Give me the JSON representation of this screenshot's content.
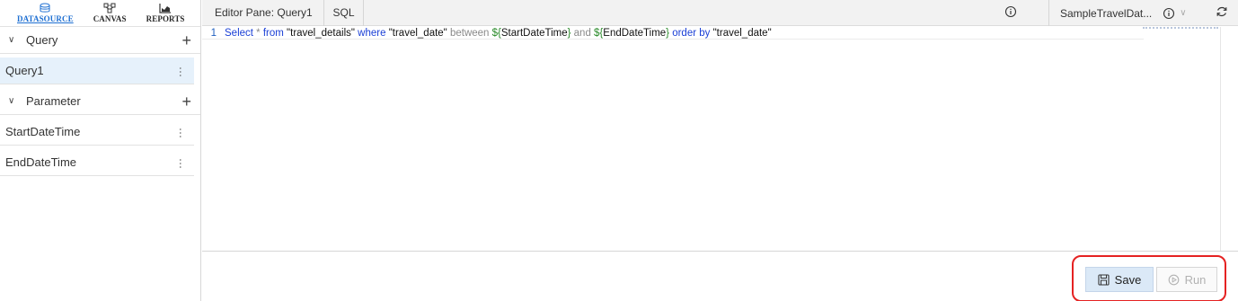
{
  "nav": {
    "datasource": "DATASOURCE",
    "canvas": "CANVAS",
    "reports": "REPORTS"
  },
  "sidebar": {
    "query_section": {
      "title": "Query",
      "items": [
        "Query1"
      ]
    },
    "parameter_section": {
      "title": "Parameter",
      "items": [
        "StartDateTime",
        "EndDateTime"
      ]
    }
  },
  "topbar": {
    "editor_tab": "Editor Pane: Query1",
    "sql_tab": "SQL",
    "datasource_name": "SampleTravelDat..."
  },
  "editor": {
    "line_number": "1",
    "tokens": [
      {
        "t": "Select",
        "c": "kw"
      },
      {
        "t": " * ",
        "c": "op"
      },
      {
        "t": "from",
        "c": "kw"
      },
      {
        "t": " \"travel_details\" ",
        "c": "str"
      },
      {
        "t": "where",
        "c": "kw"
      },
      {
        "t": " \"travel_date\" ",
        "c": "str"
      },
      {
        "t": "between",
        "c": "op"
      },
      {
        "t": " ${",
        "c": "var"
      },
      {
        "t": "StartDateTime",
        "c": "str"
      },
      {
        "t": "}",
        "c": "var"
      },
      {
        "t": " and ",
        "c": "op"
      },
      {
        "t": "${",
        "c": "var"
      },
      {
        "t": "EndDateTime",
        "c": "str"
      },
      {
        "t": "}",
        "c": "var"
      },
      {
        "t": " order by ",
        "c": "kw"
      },
      {
        "t": "\"travel_date\"",
        "c": "str"
      }
    ]
  },
  "actions": {
    "save_label": "Save",
    "run_label": "Run"
  },
  "colors": {
    "accent": "#1e6fd2",
    "highlight": "#e52222",
    "selected_bg": "#e6f1fb"
  }
}
